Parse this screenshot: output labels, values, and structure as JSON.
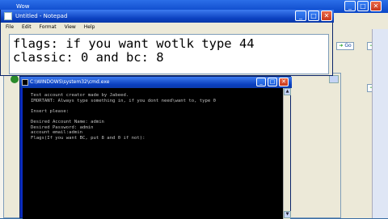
{
  "background_window": {
    "title": "Wow",
    "go_label": "Go"
  },
  "notepad": {
    "title": "Untitled - Notepad",
    "menu": [
      "File",
      "Edit",
      "Format",
      "View",
      "Help"
    ],
    "lines": [
      "flags: if you want wotlk type 44",
      "classic: 0 and bc: 8"
    ]
  },
  "cmd": {
    "title": "C:\\WINDOWS\\system32\\cmd.exe",
    "lines": [
      "Test account creator made by Jabeed.",
      "IMORTANT: Always type something in, if you dont need\\want to, type 0",
      "",
      "Insert please:",
      "",
      "Desired Account Name: admin",
      "Desired Password: admin",
      "account email:admin",
      "Flags(If you want BC, put 8 and 0 if not):"
    ]
  },
  "colors": {
    "title_blue": "#0a3fbf",
    "console_bg": "#000000",
    "console_fg": "#c0c0c0",
    "chrome": "#ece9d8"
  }
}
